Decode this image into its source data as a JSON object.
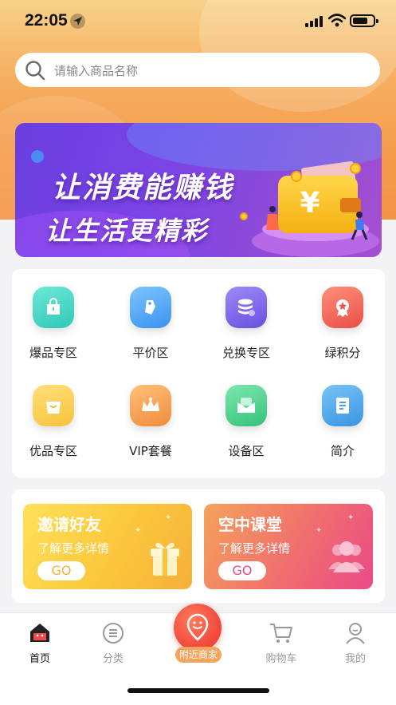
{
  "status_bar": {
    "time": "22:05"
  },
  "search": {
    "placeholder": "请输入商品名称"
  },
  "banner": {
    "line1": "让消费能赚钱",
    "line2": "让生活更精彩",
    "symbol": "¥"
  },
  "categories": [
    {
      "label": "爆品专区",
      "icon": "shopping-bag-icon",
      "color": "#3fd6c6"
    },
    {
      "label": "平价区",
      "icon": "price-tag-icon",
      "color": "#4aa8f5"
    },
    {
      "label": "兑换专区",
      "icon": "coin-stack-icon",
      "color": "#7a63e8"
    },
    {
      "label": "绿积分",
      "icon": "badge-icon",
      "color": "#f0675a"
    },
    {
      "label": "优品专区",
      "icon": "tote-bag-icon",
      "color": "#fbcd47"
    },
    {
      "label": "VIP套餐",
      "icon": "crown-icon",
      "color": "#f5a34d"
    },
    {
      "label": "设备区",
      "icon": "mail-box-icon",
      "color": "#4fd08f"
    },
    {
      "label": "简介",
      "icon": "document-icon",
      "color": "#4ba7e6"
    }
  ],
  "promos": [
    {
      "title": "邀请好友",
      "subtitle": "了解更多详情",
      "button": "GO",
      "button_color": "#f5b03a",
      "icon": "gift-icon"
    },
    {
      "title": "空中课堂",
      "subtitle": "了解更多详情",
      "button": "GO",
      "button_color": "#ea4a86",
      "icon": "people-icon"
    }
  ],
  "tabbar": {
    "home": "首页",
    "category": "分类",
    "nearby": "附近商家",
    "cart": "购物车",
    "mine": "我的"
  }
}
